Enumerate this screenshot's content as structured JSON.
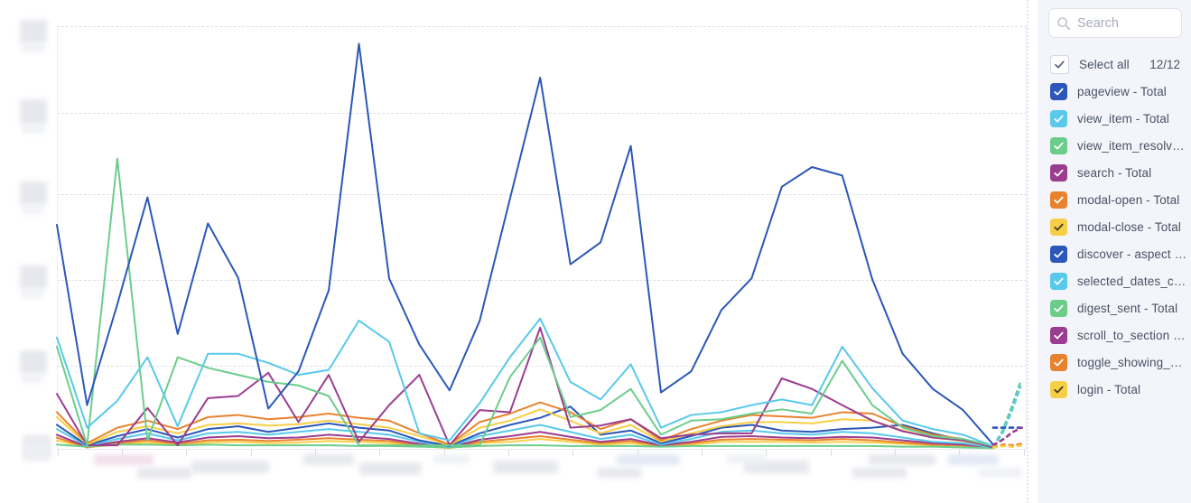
{
  "search": {
    "placeholder": "Search",
    "value": "",
    "icon": "search-icon"
  },
  "legend": {
    "select_all": {
      "label": "Select all",
      "count": "12/12",
      "checked": true
    },
    "items": [
      {
        "label": "pageview - Total",
        "color": "#2b57b8",
        "checked": true
      },
      {
        "label": "view_item - Total",
        "color": "#58c9ea",
        "checked": true
      },
      {
        "label": "view_item_resolve…",
        "color": "#6ccd8b",
        "checked": true
      },
      {
        "label": "search - Total",
        "color": "#9b3d8f",
        "checked": true
      },
      {
        "label": "modal-open - Total",
        "color": "#e8822e",
        "checked": true
      },
      {
        "label": "modal-close - Total",
        "color": "#f7cf47",
        "checked": true
      },
      {
        "label": "discover - aspect …",
        "color": "#2b57b8",
        "checked": true
      },
      {
        "label": "selected_dates_ch…",
        "color": "#58c9ea",
        "checked": true
      },
      {
        "label": "digest_sent - Total",
        "color": "#6ccd8b",
        "checked": true
      },
      {
        "label": "scroll_to_section -…",
        "color": "#9b3d8f",
        "checked": true
      },
      {
        "label": "toggle_showing_al…",
        "color": "#e8822e",
        "checked": true
      },
      {
        "label": "login - Total",
        "color": "#f7cf47",
        "checked": true
      }
    ]
  },
  "chart_data": {
    "type": "line",
    "title": "",
    "xlabel": "",
    "ylabel": "",
    "grid": true,
    "legend_position": "right",
    "x_tick_labels_redacted": true,
    "y_tick_labels_redacted": true,
    "n_points": 32,
    "x": [
      0,
      1,
      2,
      3,
      4,
      5,
      6,
      7,
      8,
      9,
      10,
      11,
      12,
      13,
      14,
      15,
      16,
      17,
      18,
      19,
      20,
      21,
      22,
      23,
      24,
      25,
      26,
      27,
      28,
      29,
      30,
      31
    ],
    "ylim": [
      0,
      6
    ],
    "y_gridlines": [
      1,
      2,
      3,
      4,
      5
    ],
    "series": [
      {
        "name": "pageview - Total",
        "color": "#2b57b8",
        "style": "solid",
        "values": [
          3.18,
          0.62,
          2.05,
          3.57,
          1.63,
          3.2,
          2.43,
          0.57,
          1.1,
          2.25,
          5.75,
          2.42,
          1.48,
          0.83,
          1.82,
          3.55,
          5.27,
          2.62,
          2.93,
          4.3,
          0.8,
          1.1,
          1.97,
          2.42,
          3.72,
          4.0,
          3.88,
          2.4,
          1.35,
          0.85,
          0.55,
          0.06
        ]
      },
      {
        "name": "view_item - Total",
        "color": "#58c9ea",
        "style": "solid",
        "values": [
          1.58,
          0.3,
          0.68,
          1.3,
          0.32,
          1.35,
          1.35,
          1.22,
          1.05,
          1.12,
          1.82,
          1.52,
          0.22,
          0.12,
          0.65,
          1.3,
          1.85,
          0.95,
          0.7,
          1.2,
          0.3,
          0.48,
          0.52,
          0.62,
          0.7,
          0.62,
          1.45,
          0.86,
          0.4,
          0.28,
          0.2,
          0.04
        ]
      },
      {
        "name": "view_item_resolve…",
        "color": "#6ccd8b",
        "style": "solid",
        "values": [
          1.45,
          0.05,
          4.12,
          0.12,
          1.3,
          1.15,
          1.05,
          0.95,
          0.9,
          0.75,
          0.05,
          0.05,
          0.05,
          0.05,
          0.05,
          1.02,
          1.58,
          0.45,
          0.55,
          0.85,
          0.2,
          0.4,
          0.42,
          0.5,
          0.56,
          0.5,
          1.25,
          0.62,
          0.3,
          0.18,
          0.14,
          0.04
        ]
      },
      {
        "name": "search - Total",
        "color": "#9b3d8f",
        "style": "solid",
        "values": [
          0.78,
          0.05,
          0.05,
          0.58,
          0.05,
          0.72,
          0.75,
          1.08,
          0.38,
          1.05,
          0.1,
          0.62,
          1.05,
          0.05,
          0.55,
          0.52,
          1.72,
          0.3,
          0.33,
          0.42,
          0.15,
          0.2,
          0.22,
          0.22,
          1.0,
          0.85,
          0.62,
          0.4,
          0.25,
          0.16,
          0.12,
          0.03
        ]
      },
      {
        "name": "modal-open - Total",
        "color": "#e8822e",
        "style": "solid",
        "values": [
          0.52,
          0.08,
          0.3,
          0.4,
          0.28,
          0.45,
          0.48,
          0.42,
          0.45,
          0.5,
          0.44,
          0.4,
          0.22,
          0.06,
          0.38,
          0.5,
          0.66,
          0.52,
          0.28,
          0.42,
          0.12,
          0.28,
          0.4,
          0.48,
          0.46,
          0.44,
          0.52,
          0.5,
          0.32,
          0.2,
          0.14,
          0.03
        ]
      },
      {
        "name": "modal-close - Total",
        "color": "#f7cf47",
        "style": "solid",
        "values": [
          0.45,
          0.06,
          0.24,
          0.32,
          0.22,
          0.34,
          0.36,
          0.33,
          0.35,
          0.4,
          0.35,
          0.3,
          0.18,
          0.05,
          0.3,
          0.4,
          0.56,
          0.4,
          0.22,
          0.34,
          0.1,
          0.22,
          0.32,
          0.38,
          0.38,
          0.36,
          0.42,
          0.4,
          0.26,
          0.16,
          0.11,
          0.03
        ]
      },
      {
        "name": "discover - aspect …",
        "color": "#2b57b8",
        "style": "solid",
        "values": [
          0.34,
          0.05,
          0.18,
          0.28,
          0.16,
          0.28,
          0.32,
          0.24,
          0.3,
          0.36,
          0.3,
          0.26,
          0.12,
          0.04,
          0.22,
          0.34,
          0.44,
          0.6,
          0.2,
          0.26,
          0.08,
          0.18,
          0.3,
          0.34,
          0.26,
          0.24,
          0.28,
          0.3,
          0.34,
          0.22,
          0.12,
          0.02
        ]
      },
      {
        "name": "selected_dates_ch…",
        "color": "#58c9ea",
        "style": "solid",
        "values": [
          0.28,
          0.04,
          0.14,
          0.22,
          0.12,
          0.22,
          0.24,
          0.2,
          0.24,
          0.28,
          0.24,
          0.2,
          0.1,
          0.03,
          0.18,
          0.26,
          0.34,
          0.24,
          0.14,
          0.2,
          0.06,
          0.14,
          0.24,
          0.26,
          0.22,
          0.2,
          0.24,
          0.22,
          0.16,
          0.1,
          0.08,
          0.02
        ]
      },
      {
        "name": "digest_sent - Total",
        "color": "#6ccd8b",
        "style": "solid",
        "values": [
          0.06,
          0.03,
          0.06,
          0.06,
          0.05,
          0.06,
          0.05,
          0.05,
          0.05,
          0.05,
          0.04,
          0.04,
          0.03,
          0.02,
          0.04,
          0.05,
          0.05,
          0.04,
          0.04,
          0.04,
          0.03,
          0.04,
          0.04,
          0.04,
          0.04,
          0.04,
          0.04,
          0.04,
          0.03,
          0.03,
          0.02,
          0.01
        ]
      },
      {
        "name": "scroll_to_section -…",
        "color": "#9b3d8f",
        "style": "solid",
        "values": [
          0.2,
          0.03,
          0.1,
          0.15,
          0.09,
          0.16,
          0.18,
          0.15,
          0.16,
          0.2,
          0.17,
          0.14,
          0.07,
          0.02,
          0.13,
          0.18,
          0.24,
          0.17,
          0.1,
          0.14,
          0.05,
          0.1,
          0.17,
          0.18,
          0.16,
          0.15,
          0.17,
          0.16,
          0.12,
          0.08,
          0.06,
          0.02
        ]
      },
      {
        "name": "toggle_showing_al…",
        "color": "#e8822e",
        "style": "solid",
        "values": [
          0.16,
          0.02,
          0.08,
          0.12,
          0.07,
          0.12,
          0.13,
          0.11,
          0.13,
          0.15,
          0.13,
          0.11,
          0.05,
          0.02,
          0.1,
          0.14,
          0.18,
          0.13,
          0.08,
          0.11,
          0.04,
          0.08,
          0.13,
          0.14,
          0.13,
          0.12,
          0.14,
          0.12,
          0.09,
          0.06,
          0.05,
          0.01
        ]
      },
      {
        "name": "login - Total",
        "color": "#f7cf47",
        "style": "solid",
        "values": [
          0.12,
          0.02,
          0.06,
          0.09,
          0.05,
          0.09,
          0.1,
          0.08,
          0.09,
          0.11,
          0.1,
          0.08,
          0.04,
          0.01,
          0.08,
          0.1,
          0.14,
          0.1,
          0.06,
          0.08,
          0.03,
          0.06,
          0.1,
          0.1,
          0.1,
          0.09,
          0.1,
          0.09,
          0.07,
          0.05,
          0.04,
          0.01
        ]
      }
    ],
    "projection": {
      "note": "dashed forecast stubs at right edge",
      "series": [
        {
          "color": "#6ccd8b",
          "points": [
            [
              31,
              0.03
            ],
            [
              31.3,
              0.25
            ],
            [
              31.6,
              0.58
            ],
            [
              31.9,
              0.95
            ]
          ]
        },
        {
          "color": "#58c9ea",
          "points": [
            [
              31,
              0.03
            ],
            [
              31.3,
              0.22
            ],
            [
              31.6,
              0.52
            ],
            [
              31.9,
              0.88
            ]
          ]
        },
        {
          "color": "#2b57b8",
          "points": [
            [
              31,
              0.3
            ],
            [
              31.3,
              0.3
            ],
            [
              31.6,
              0.3
            ],
            [
              31.9,
              0.3
            ]
          ]
        },
        {
          "color": "#9b3d8f",
          "points": [
            [
              31,
              0.05
            ],
            [
              31.35,
              0.14
            ],
            [
              31.65,
              0.24
            ],
            [
              31.95,
              0.3
            ]
          ]
        },
        {
          "color": "#e8822e",
          "points": [
            [
              31,
              0.03
            ],
            [
              31.35,
              0.06
            ],
            [
              31.65,
              0.05
            ],
            [
              31.95,
              0.07
            ]
          ]
        },
        {
          "color": "#f7cf47",
          "points": [
            [
              31,
              0.02
            ],
            [
              31.35,
              0.04
            ],
            [
              31.65,
              0.03
            ],
            [
              31.95,
              0.05
            ]
          ]
        }
      ]
    }
  }
}
